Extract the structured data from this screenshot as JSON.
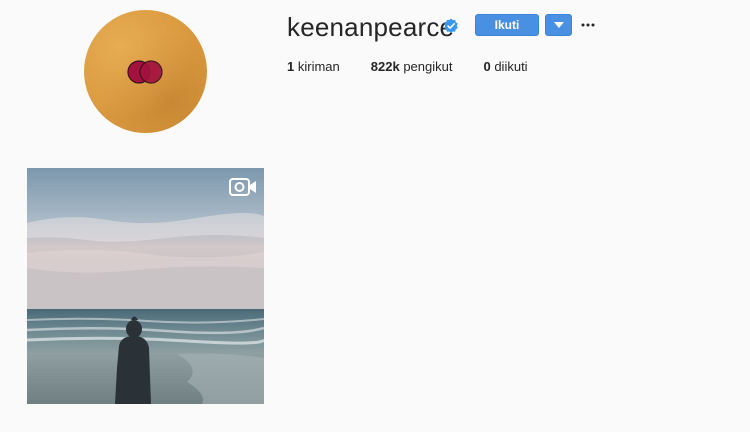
{
  "profile": {
    "username": "keenanpearce",
    "verified": true,
    "follow_label": "Ikuti",
    "stats": [
      {
        "count": "1",
        "label": "kiriman"
      },
      {
        "count": "822k",
        "label": "pengikut"
      },
      {
        "count": "0",
        "label": "diikuti"
      }
    ]
  },
  "icons": {
    "verified": "verified-badge-icon",
    "dropdown": "chevron-down-icon",
    "more": "more-options-icon",
    "video": "video-camera-icon"
  },
  "colors": {
    "primary": "#4a90e2",
    "background": "#fafafa",
    "text": "#262626",
    "avatar_bg": "#d9983e",
    "avatar_dots": "#a3123e"
  }
}
